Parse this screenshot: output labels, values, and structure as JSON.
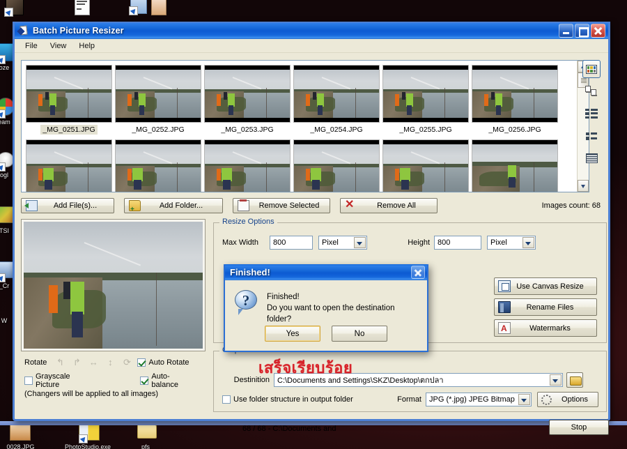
{
  "window": {
    "title": "Batch Picture Resizer",
    "icon": "picture-resizer-icon",
    "caption_buttons": {
      "minimize": "minimize-button",
      "maximize": "maximize-button",
      "close": "close-button"
    }
  },
  "menubar": {
    "items": [
      {
        "label": "File"
      },
      {
        "label": "View"
      },
      {
        "label": "Help"
      }
    ]
  },
  "thumbnails": {
    "row1": [
      {
        "name": "_MG_0251.JPG",
        "selected": true
      },
      {
        "name": "_MG_0252.JPG",
        "selected": false
      },
      {
        "name": "_MG_0253.JPG",
        "selected": false
      },
      {
        "name": "_MG_0254.JPG",
        "selected": false
      },
      {
        "name": "_MG_0255.JPG",
        "selected": false
      },
      {
        "name": "_MG_0256.JPG",
        "selected": false
      }
    ],
    "row2_count": 6
  },
  "view_modes": [
    {
      "name": "thumbnails-view",
      "active": true
    },
    {
      "name": "large-icons-view",
      "active": false
    },
    {
      "name": "tiles-view",
      "active": false
    },
    {
      "name": "list-view",
      "active": false
    },
    {
      "name": "details-view",
      "active": false
    }
  ],
  "toolbar": {
    "add_files": "Add File(s)...",
    "add_folder": "Add Folder...",
    "remove_selected": "Remove Selected",
    "remove_all": "Remove All",
    "images_count": "Images count: 68"
  },
  "rotate": {
    "label": "Rotate",
    "icons": [
      "rotate-left-icon",
      "rotate-right-icon",
      "flip-horizontal-icon",
      "flip-vertical-icon",
      "auto-rotate-icon"
    ],
    "auto_rotate": {
      "label": "Auto Rotate",
      "checked": true
    }
  },
  "options": {
    "grayscale": {
      "label": "Grayscale Picture",
      "checked": false
    },
    "auto_balance": {
      "label": "Auto-balance",
      "checked": true
    },
    "note": "(Changers will be applied to all images)"
  },
  "resize_options": {
    "title": "Resize Options",
    "max_width_label": "Max Width",
    "max_width_value": "800",
    "max_width_unit": "Pixel",
    "max_height_label": "Height",
    "max_height_value": "800",
    "max_height_unit": "Pixel",
    "buttons": [
      {
        "label": "Use Canvas Resize",
        "icon": "canvas-resize-icon"
      },
      {
        "label": "Rename Files",
        "icon": "rename-files-icon"
      },
      {
        "label": "Watermarks",
        "icon": "watermarks-icon"
      }
    ]
  },
  "output": {
    "title": "Output",
    "destination_label": "Destinition",
    "destination_value": "C:\\Documents and Settings\\SKZ\\Desktop\\ตกปลา",
    "browse_icon": "open-folder-icon",
    "use_folder_structure": {
      "label": "Use folder structure in output folder",
      "checked": false
    },
    "format_label": "Format",
    "format_value": "JPG (*.jpg) JPEG Bitmap",
    "options_button": "Options"
  },
  "status": {
    "progress_text": "68 / 68 - C:\\Documents and",
    "stop_button": "Stop"
  },
  "annotation": {
    "thai_note": "เสร็จเรียบร้อย",
    "color": "#d8232a"
  },
  "dialog": {
    "title": "Finished!",
    "icon": "question-icon",
    "line1": "Finished!",
    "line2": "Do you want to open the destination folder?",
    "yes": "Yes",
    "no": "No",
    "close_icon": "dialog-close-icon"
  },
  "desktop": {
    "icons": [
      {
        "label": "_0028.JPG",
        "type": "image-file-icon"
      },
      {
        "label": "PhotoStudio.exe",
        "type": "shortcut-icon"
      },
      {
        "label": "pfs",
        "type": "folder-icon"
      }
    ],
    "left_edge_labels": [
      "oze",
      "eam",
      "ogl",
      "TSI",
      "_Cr",
      "W"
    ]
  },
  "colors": {
    "title_blue": "#1668d8",
    "window_face": "#ece9d8",
    "accent_border": "#4b7fd4",
    "group_title": "#15428b"
  }
}
